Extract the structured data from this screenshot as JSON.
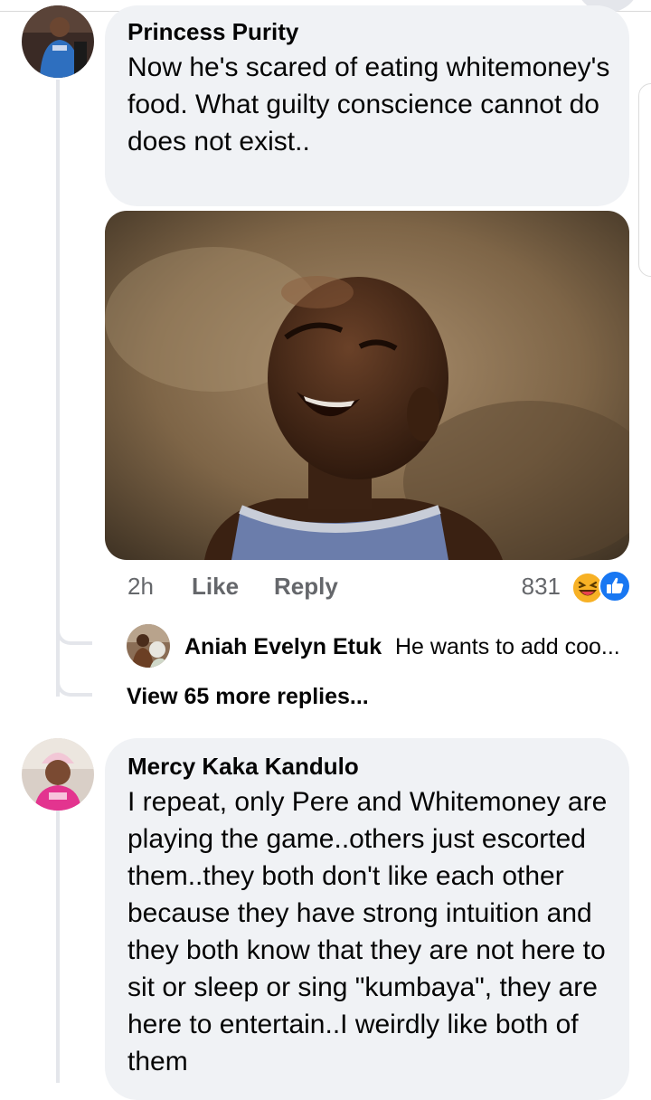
{
  "comments": [
    {
      "author": "Princess Purity",
      "text": "Now he's scared of eating whitemoney's food. What guilty conscience cannot do does not exist..",
      "time": "2h",
      "like_label": "Like",
      "reply_label": "Reply",
      "reaction_count": "831",
      "reactions": [
        "laugh-emoji-icon",
        "like-reaction-icon"
      ],
      "replies": [
        {
          "author": "Aniah Evelyn Etuk",
          "text": "He wants to add coo..."
        }
      ],
      "view_more": "View 65 more replies..."
    },
    {
      "author": "Mercy Kaka Kandulo",
      "text": "I repeat, only Pere and Whitemoney are playing the game..others just escorted them..they both don't like each other because they have strong intuition and they both know that they are not here to sit or sleep or sing \"kumbaya\", they are here to entertain..I weirdly like both of them"
    }
  ],
  "colors": {
    "bubble": "#f0f2f5",
    "meta_text": "#65676b",
    "thread_line": "#e4e6eb",
    "like_blue": "#1877f2",
    "laugh_yellow": "#f7b125"
  }
}
